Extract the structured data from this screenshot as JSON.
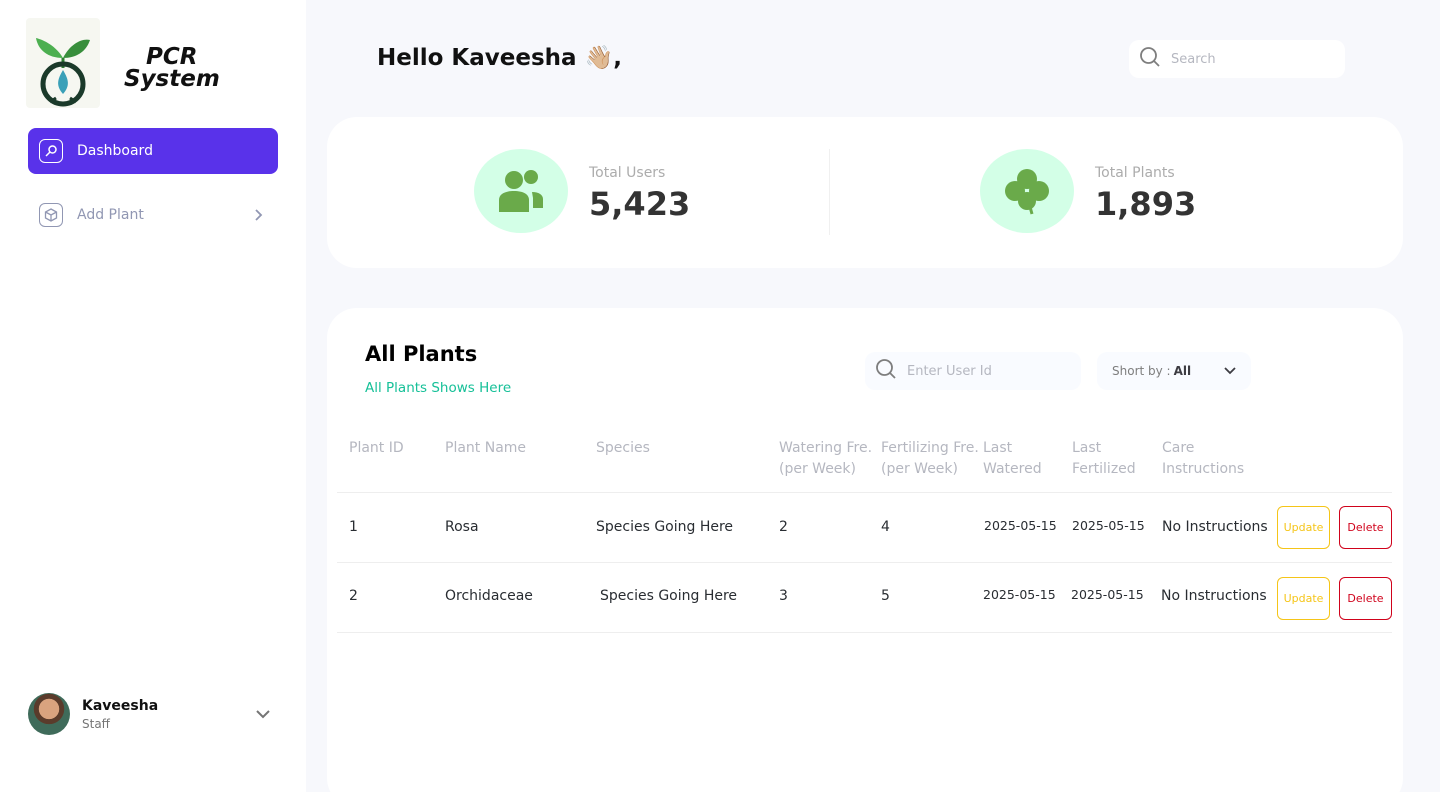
{
  "brand": {
    "line1": "PCR",
    "line2": "System"
  },
  "nav": {
    "dashboard": "Dashboard",
    "add_plant": "Add Plant"
  },
  "profile": {
    "name": "Kaveesha",
    "role": "Staff"
  },
  "header": {
    "greeting": "Hello Kaveesha 👋🏼,",
    "search_placeholder": "Search"
  },
  "stats": {
    "users_label": "Total Users",
    "users_value": "5,423",
    "plants_label": "Total Plants",
    "plants_value": "1,893"
  },
  "plants": {
    "title": "All Plants",
    "subtitle": "All Plants Shows Here",
    "search_placeholder": "Enter User Id",
    "sort_label": "Short by :",
    "sort_value": "All",
    "columns": [
      "Plant ID",
      "Plant Name",
      "Species",
      "Watering Fre.\n(per Week)",
      "Fertilizing Fre.\n(per Week)",
      "Last\nWatered",
      "Last\nFertilized",
      "Care\nInstructions"
    ],
    "rows": [
      {
        "id": "1",
        "name": "Rosa",
        "species": "Species Going Here",
        "watering": "2",
        "fertilizing": "4",
        "last_watered": "2025-05-15",
        "last_fertilized": "2025-05-15",
        "care": "No Instructions"
      },
      {
        "id": "2",
        "name": "Orchidaceae",
        "species": "Species Going Here",
        "watering": "3",
        "fertilizing": "5",
        "last_watered": "2025-05-15",
        "last_fertilized": "2025-05-15",
        "care": "No Instructions"
      }
    ],
    "update_label": "Update",
    "delete_label": "Delete"
  },
  "colors": {
    "primary": "#5932ea",
    "accent_green": "#16c098",
    "stat_bg": "#d3ffe7",
    "stat_icon": "#6aaa4a",
    "update": "#f5c518",
    "delete": "#d0021b"
  },
  "icons": [
    "search-icon",
    "key-icon",
    "box-icon",
    "chevron-right-icon",
    "chevron-down-icon",
    "users-icon",
    "clover-icon",
    "plant-logo-icon"
  ]
}
